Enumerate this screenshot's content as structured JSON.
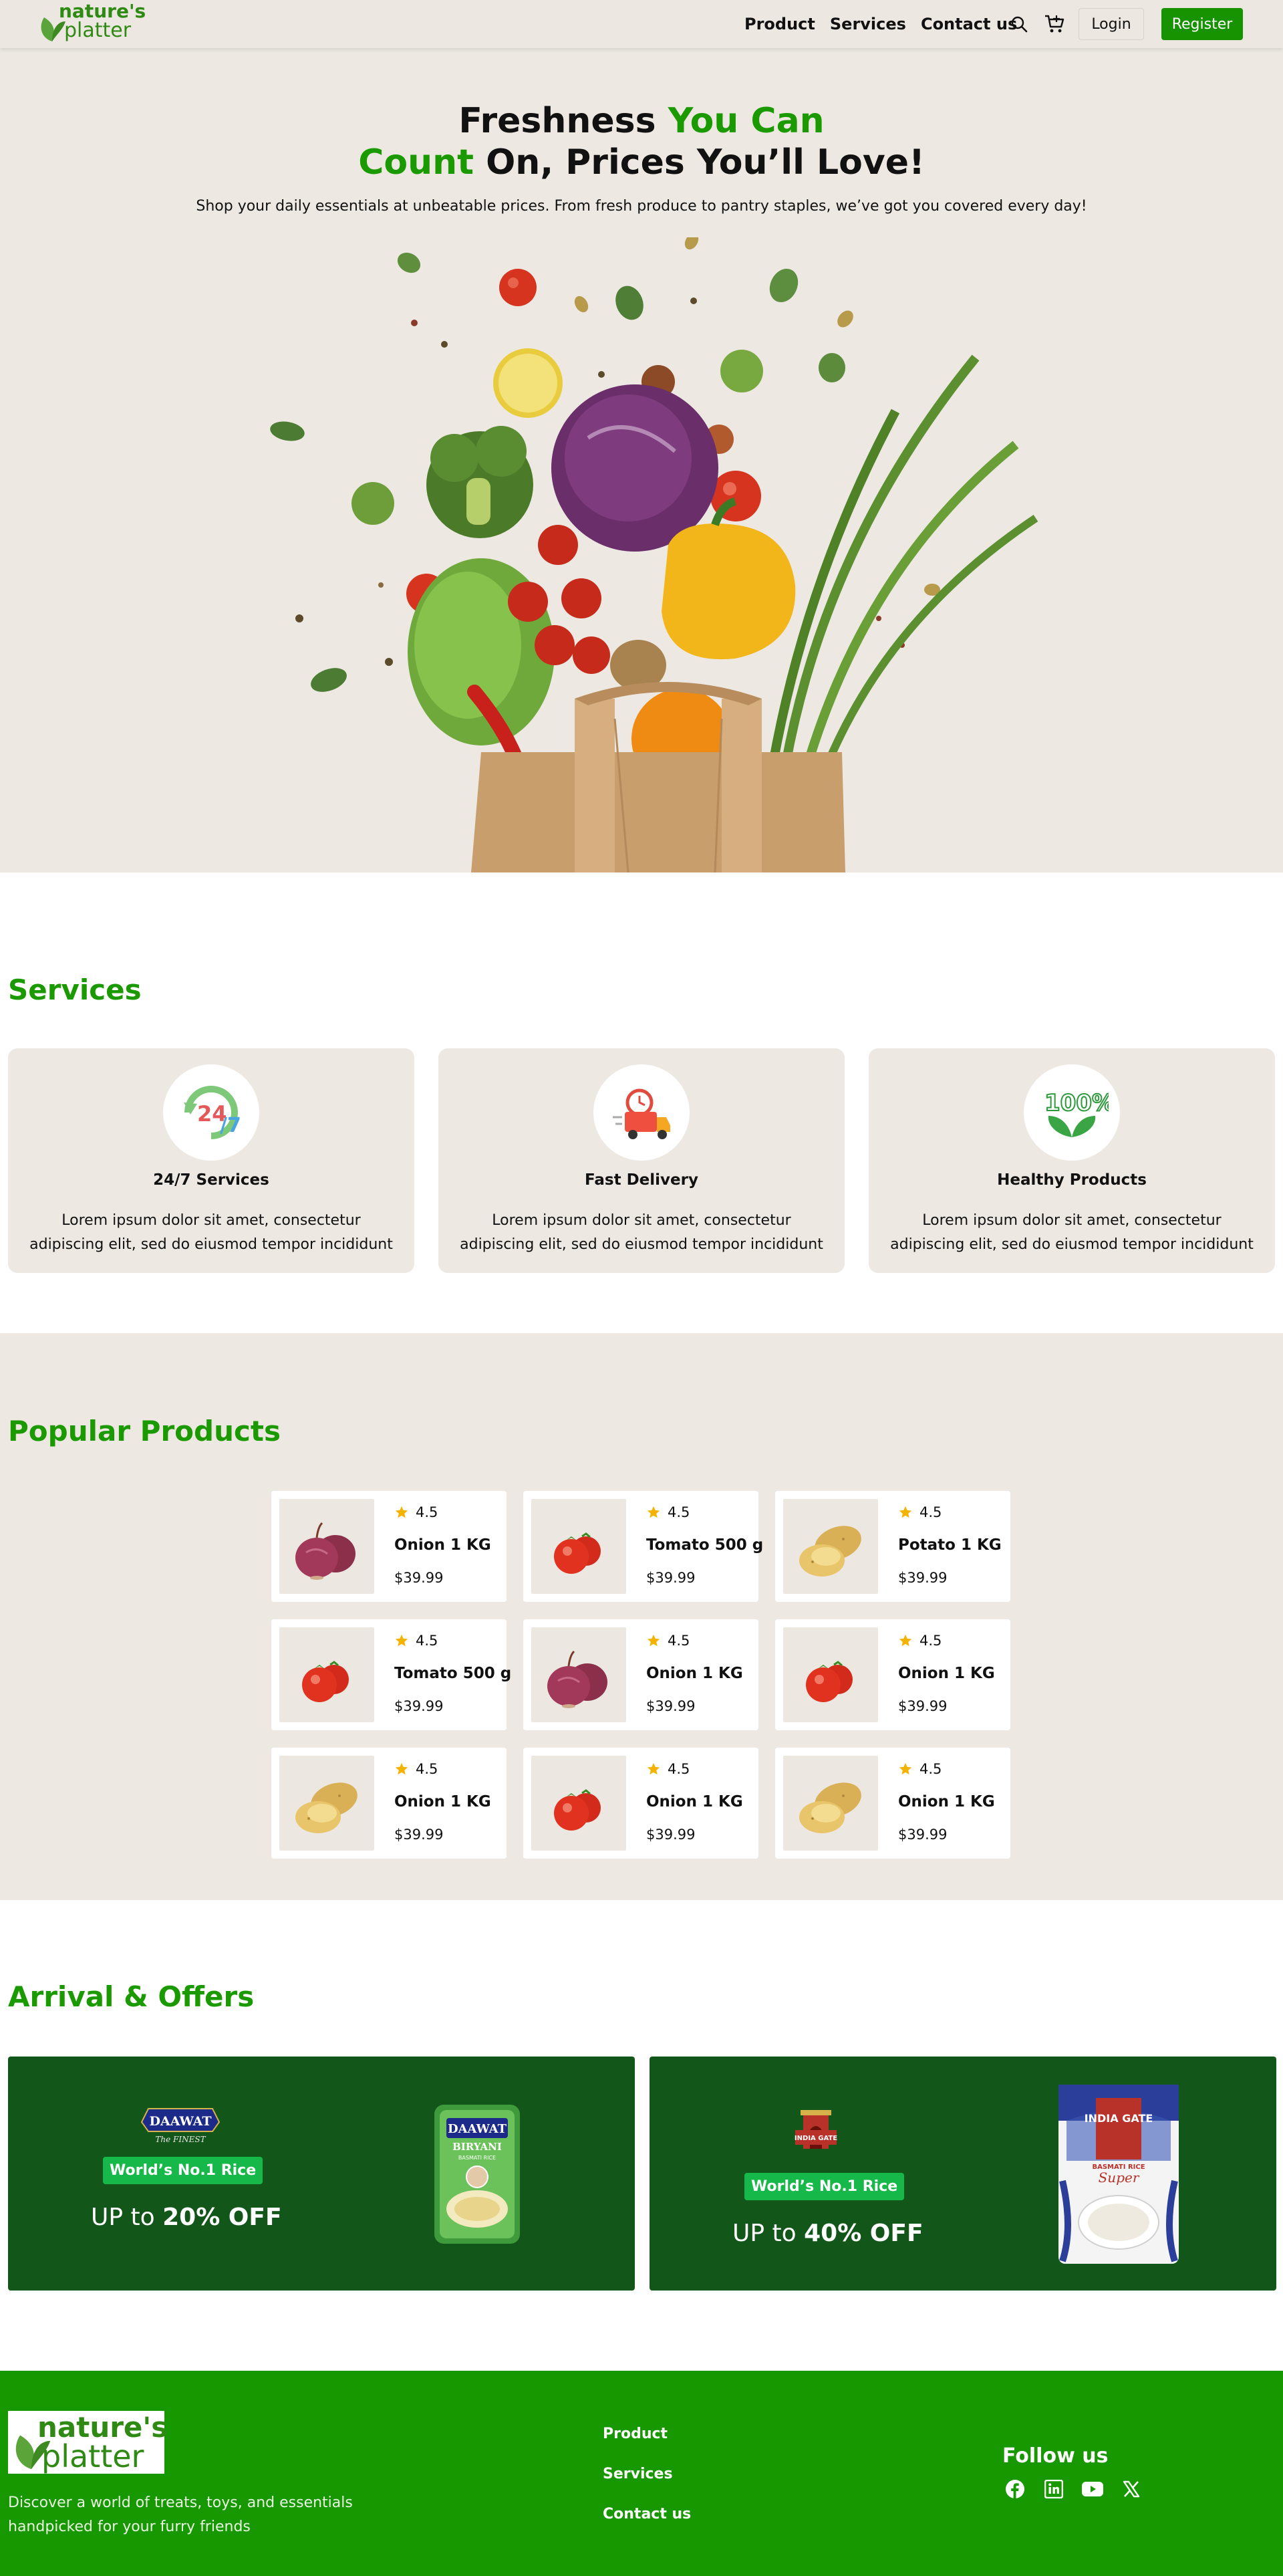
{
  "brand": {
    "logo_line1": "nature's",
    "logo_line2": "platter"
  },
  "nav": {
    "links": [
      "Product",
      "Services",
      "Contact us"
    ],
    "login_label": "Login",
    "register_label": "Register"
  },
  "hero": {
    "title_part1": "Freshness ",
    "title_part2": "You Can",
    "title_part3": "Count",
    "title_part4": " On, Prices You’ll Love!",
    "subtitle": "Shop your daily essentials at unbeatable prices. From fresh produce to pantry staples, we’ve got you covered every day!"
  },
  "services": {
    "title": "Services",
    "cards": [
      {
        "icon": "24-7-icon",
        "title": "24/7 Services",
        "desc": "Lorem ipsum dolor sit amet, consectetur adipiscing elit, sed do eiusmod tempor incididunt"
      },
      {
        "icon": "delivery-truck-icon",
        "title": "Fast Delivery",
        "desc": "Lorem ipsum dolor sit amet, consectetur adipiscing elit, sed do eiusmod tempor incididunt"
      },
      {
        "icon": "100-percent-leaf-icon",
        "title": "Healthy Products",
        "desc": "Lorem ipsum dolor sit amet, consectetur adipiscing elit, sed do eiusmod tempor incididunt"
      }
    ]
  },
  "products": {
    "title": "Popular Products",
    "items": [
      {
        "image": "onion",
        "rating": "4.5",
        "name": "Onion 1 KG",
        "price": "$39.99"
      },
      {
        "image": "tomato",
        "rating": "4.5",
        "name": "Tomato 500 g",
        "price": "$39.99"
      },
      {
        "image": "potato",
        "rating": "4.5",
        "name": "Potato 1 KG",
        "price": "$39.99"
      },
      {
        "image": "tomato",
        "rating": "4.5",
        "name": "Tomato 500 g",
        "price": "$39.99"
      },
      {
        "image": "onion",
        "rating": "4.5",
        "name": "Onion 1 KG",
        "price": "$39.99"
      },
      {
        "image": "tomato",
        "rating": "4.5",
        "name": "Onion 1 KG",
        "price": "$39.99"
      },
      {
        "image": "potato",
        "rating": "4.5",
        "name": "Onion 1 KG",
        "price": "$39.99"
      },
      {
        "image": "tomato",
        "rating": "4.5",
        "name": "Onion 1 KG",
        "price": "$39.99"
      },
      {
        "image": "potato",
        "rating": "4.5",
        "name": "Onion 1 KG",
        "price": "$39.99"
      }
    ]
  },
  "offers": {
    "title": "Arrival & Offers",
    "items": [
      {
        "brand_name": "DAAWAT",
        "brand_tagline": "The FINEST",
        "pack_brand": "DAAWAT",
        "pack_variety": "BIRYANI",
        "pack_sub": "BASMATI RICE",
        "badge": "World’s No.1 Rice",
        "prefix": "UP to ",
        "discount": "20% OFF"
      },
      {
        "brand_name": "INDIA GATE",
        "pack_brand": "INDIA GATE",
        "pack_sub": "BASMATI RICE",
        "pack_variety": "Super",
        "badge": "World’s No.1 Rice",
        "prefix": "UP to ",
        "discount": "40% OFF"
      }
    ]
  },
  "footer": {
    "logo_line1": "nature's",
    "logo_line2": "platter",
    "description": "Discover a world of treats, toys, and essentials handpicked for your furry friends",
    "links": [
      "Product",
      "Services",
      "Contact us"
    ],
    "follow_title": "Follow us",
    "social": [
      "facebook-icon",
      "linkedin-icon",
      "youtube-icon",
      "x-icon"
    ]
  },
  "colors": {
    "brand_green": "#1a9a00",
    "cream_bg": "#ede9e2",
    "offer_bg": "#12561a",
    "badge_green": "#17b84a",
    "footer_green": "#179700"
  }
}
